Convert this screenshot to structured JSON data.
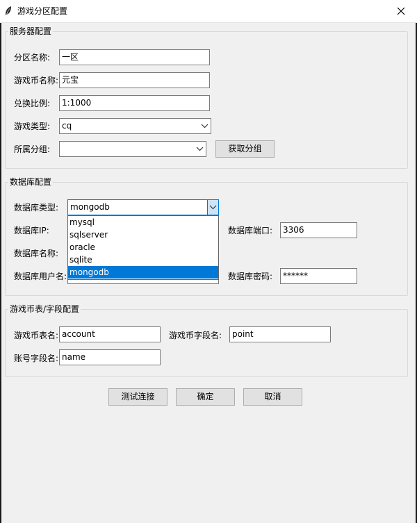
{
  "window": {
    "title": "游戏分区配置"
  },
  "server": {
    "group_title": "服务器配置",
    "zone_name_label": "分区名称:",
    "zone_name_value": "一区",
    "currency_name_label": "游戏币名称:",
    "currency_name_value": "元宝",
    "ratio_label": "兑换比例:",
    "ratio_value": "1:1000",
    "game_type_label": "游戏类型:",
    "game_type_value": "cq",
    "group_label": "所属分组:",
    "group_value": "",
    "fetch_group_button": "获取分组"
  },
  "database": {
    "group_title": "数据库配置",
    "db_type_label": "数据库类型:",
    "db_type_value": "mongodb",
    "db_ip_label": "数据库IP:",
    "db_port_label": "数据库端口:",
    "db_port_value": "3306",
    "db_name_label": "数据库名称:",
    "db_user_label": "数据库用户名:",
    "db_password_label": "数据库密码:",
    "db_password_value": "******",
    "dropdown_options": [
      "mysql",
      "sqlserver",
      "oracle",
      "sqlite",
      "mongodb"
    ],
    "dropdown_selected_index": 4
  },
  "currency_table": {
    "group_title": "游戏币表/字段配置",
    "table_label": "游戏币表名:",
    "table_value": "account",
    "field_label": "游戏币字段名:",
    "field_value": "point",
    "account_field_label": "账号字段名:",
    "account_field_value": "name"
  },
  "buttons": {
    "test": "测试连接",
    "ok": "确定",
    "cancel": "取消"
  },
  "colors": {
    "accent": "#0078d7",
    "window_bg": "#f0f0f0"
  }
}
